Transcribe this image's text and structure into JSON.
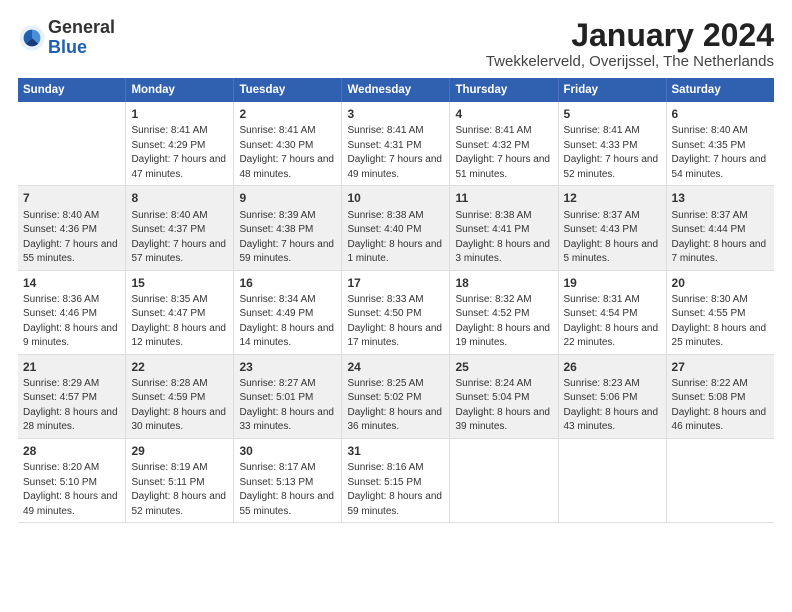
{
  "header": {
    "logo_general": "General",
    "logo_blue": "Blue",
    "title": "January 2024",
    "subtitle": "Twekkelerveld, Overijssel, The Netherlands"
  },
  "days_of_week": [
    "Sunday",
    "Monday",
    "Tuesday",
    "Wednesday",
    "Thursday",
    "Friday",
    "Saturday"
  ],
  "weeks": [
    [
      {
        "day": "",
        "sunrise": "",
        "sunset": "",
        "daylight": ""
      },
      {
        "day": "1",
        "sunrise": "Sunrise: 8:41 AM",
        "sunset": "Sunset: 4:29 PM",
        "daylight": "Daylight: 7 hours and 47 minutes."
      },
      {
        "day": "2",
        "sunrise": "Sunrise: 8:41 AM",
        "sunset": "Sunset: 4:30 PM",
        "daylight": "Daylight: 7 hours and 48 minutes."
      },
      {
        "day": "3",
        "sunrise": "Sunrise: 8:41 AM",
        "sunset": "Sunset: 4:31 PM",
        "daylight": "Daylight: 7 hours and 49 minutes."
      },
      {
        "day": "4",
        "sunrise": "Sunrise: 8:41 AM",
        "sunset": "Sunset: 4:32 PM",
        "daylight": "Daylight: 7 hours and 51 minutes."
      },
      {
        "day": "5",
        "sunrise": "Sunrise: 8:41 AM",
        "sunset": "Sunset: 4:33 PM",
        "daylight": "Daylight: 7 hours and 52 minutes."
      },
      {
        "day": "6",
        "sunrise": "Sunrise: 8:40 AM",
        "sunset": "Sunset: 4:35 PM",
        "daylight": "Daylight: 7 hours and 54 minutes."
      }
    ],
    [
      {
        "day": "7",
        "sunrise": "Sunrise: 8:40 AM",
        "sunset": "Sunset: 4:36 PM",
        "daylight": "Daylight: 7 hours and 55 minutes."
      },
      {
        "day": "8",
        "sunrise": "Sunrise: 8:40 AM",
        "sunset": "Sunset: 4:37 PM",
        "daylight": "Daylight: 7 hours and 57 minutes."
      },
      {
        "day": "9",
        "sunrise": "Sunrise: 8:39 AM",
        "sunset": "Sunset: 4:38 PM",
        "daylight": "Daylight: 7 hours and 59 minutes."
      },
      {
        "day": "10",
        "sunrise": "Sunrise: 8:38 AM",
        "sunset": "Sunset: 4:40 PM",
        "daylight": "Daylight: 8 hours and 1 minute."
      },
      {
        "day": "11",
        "sunrise": "Sunrise: 8:38 AM",
        "sunset": "Sunset: 4:41 PM",
        "daylight": "Daylight: 8 hours and 3 minutes."
      },
      {
        "day": "12",
        "sunrise": "Sunrise: 8:37 AM",
        "sunset": "Sunset: 4:43 PM",
        "daylight": "Daylight: 8 hours and 5 minutes."
      },
      {
        "day": "13",
        "sunrise": "Sunrise: 8:37 AM",
        "sunset": "Sunset: 4:44 PM",
        "daylight": "Daylight: 8 hours and 7 minutes."
      }
    ],
    [
      {
        "day": "14",
        "sunrise": "Sunrise: 8:36 AM",
        "sunset": "Sunset: 4:46 PM",
        "daylight": "Daylight: 8 hours and 9 minutes."
      },
      {
        "day": "15",
        "sunrise": "Sunrise: 8:35 AM",
        "sunset": "Sunset: 4:47 PM",
        "daylight": "Daylight: 8 hours and 12 minutes."
      },
      {
        "day": "16",
        "sunrise": "Sunrise: 8:34 AM",
        "sunset": "Sunset: 4:49 PM",
        "daylight": "Daylight: 8 hours and 14 minutes."
      },
      {
        "day": "17",
        "sunrise": "Sunrise: 8:33 AM",
        "sunset": "Sunset: 4:50 PM",
        "daylight": "Daylight: 8 hours and 17 minutes."
      },
      {
        "day": "18",
        "sunrise": "Sunrise: 8:32 AM",
        "sunset": "Sunset: 4:52 PM",
        "daylight": "Daylight: 8 hours and 19 minutes."
      },
      {
        "day": "19",
        "sunrise": "Sunrise: 8:31 AM",
        "sunset": "Sunset: 4:54 PM",
        "daylight": "Daylight: 8 hours and 22 minutes."
      },
      {
        "day": "20",
        "sunrise": "Sunrise: 8:30 AM",
        "sunset": "Sunset: 4:55 PM",
        "daylight": "Daylight: 8 hours and 25 minutes."
      }
    ],
    [
      {
        "day": "21",
        "sunrise": "Sunrise: 8:29 AM",
        "sunset": "Sunset: 4:57 PM",
        "daylight": "Daylight: 8 hours and 28 minutes."
      },
      {
        "day": "22",
        "sunrise": "Sunrise: 8:28 AM",
        "sunset": "Sunset: 4:59 PM",
        "daylight": "Daylight: 8 hours and 30 minutes."
      },
      {
        "day": "23",
        "sunrise": "Sunrise: 8:27 AM",
        "sunset": "Sunset: 5:01 PM",
        "daylight": "Daylight: 8 hours and 33 minutes."
      },
      {
        "day": "24",
        "sunrise": "Sunrise: 8:25 AM",
        "sunset": "Sunset: 5:02 PM",
        "daylight": "Daylight: 8 hours and 36 minutes."
      },
      {
        "day": "25",
        "sunrise": "Sunrise: 8:24 AM",
        "sunset": "Sunset: 5:04 PM",
        "daylight": "Daylight: 8 hours and 39 minutes."
      },
      {
        "day": "26",
        "sunrise": "Sunrise: 8:23 AM",
        "sunset": "Sunset: 5:06 PM",
        "daylight": "Daylight: 8 hours and 43 minutes."
      },
      {
        "day": "27",
        "sunrise": "Sunrise: 8:22 AM",
        "sunset": "Sunset: 5:08 PM",
        "daylight": "Daylight: 8 hours and 46 minutes."
      }
    ],
    [
      {
        "day": "28",
        "sunrise": "Sunrise: 8:20 AM",
        "sunset": "Sunset: 5:10 PM",
        "daylight": "Daylight: 8 hours and 49 minutes."
      },
      {
        "day": "29",
        "sunrise": "Sunrise: 8:19 AM",
        "sunset": "Sunset: 5:11 PM",
        "daylight": "Daylight: 8 hours and 52 minutes."
      },
      {
        "day": "30",
        "sunrise": "Sunrise: 8:17 AM",
        "sunset": "Sunset: 5:13 PM",
        "daylight": "Daylight: 8 hours and 55 minutes."
      },
      {
        "day": "31",
        "sunrise": "Sunrise: 8:16 AM",
        "sunset": "Sunset: 5:15 PM",
        "daylight": "Daylight: 8 hours and 59 minutes."
      },
      {
        "day": "",
        "sunrise": "",
        "sunset": "",
        "daylight": ""
      },
      {
        "day": "",
        "sunrise": "",
        "sunset": "",
        "daylight": ""
      },
      {
        "day": "",
        "sunrise": "",
        "sunset": "",
        "daylight": ""
      }
    ]
  ]
}
